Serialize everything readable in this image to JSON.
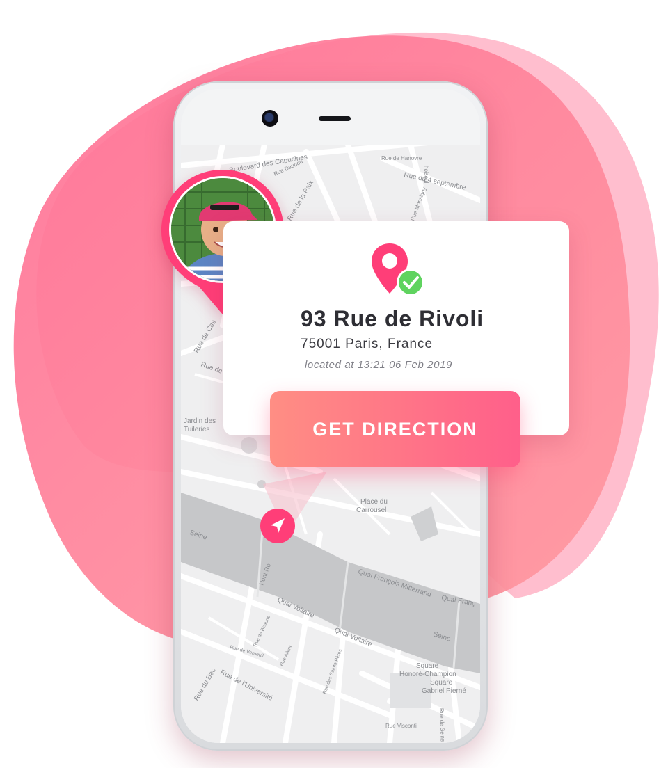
{
  "colors": {
    "accent": "#ff3e78",
    "blob_main": "#ff7fa0",
    "blob_light": "#ffb0c4",
    "check_green": "#5fd35f",
    "button_start": "#ff8e84",
    "button_end": "#ff5f8a"
  },
  "location_card": {
    "icon": "location-pin-check-icon",
    "address": "93 Rue de Rivoli",
    "city": "75001 Paris, France",
    "located_at": "located at 13:21 06 Feb 2019"
  },
  "actions": {
    "get_direction_label": "GET DIRECTION"
  },
  "avatar": {
    "icon": "avatar-child-photo"
  },
  "nav_marker": {
    "icon": "navigation-arrow-icon"
  },
  "map_labels": {
    "boulevard_capucines": "Boulevard des Capucines",
    "rue_hanovre": "Rue de Hanovre",
    "rue_4_septembre": "Rue du 4 septembre",
    "rue_daunou": "Rue Daunou",
    "rue_paix": "Rue de la Paix",
    "rue_monsigny": "Rue Monsigny",
    "choiseul": "hoiseul",
    "rue_de_cas": "Rue de Cas",
    "rue_de": "Rue de",
    "jardin_tuileries": "Jardin des\nTuileries",
    "place_carrousel": "Place du\nCarrousel",
    "seine_1": "Seine",
    "seine_2": "Seine",
    "pont_royal": "Pont Ro",
    "quai_mitterrand": "Quai François Mitterrand",
    "quai_franc": "Quai Franç",
    "quai_voltaire_1": "Quai Voltaire",
    "quai_voltaire_2": "Quai Voltaire",
    "rue_beaune": "Rue de Beaune",
    "rue_verneuil": "Rue de Verneuil",
    "rue_allent": "Rue Allent",
    "rue_saints_peres": "Rue des Saints-Pères",
    "rue_bac": "Rue du Bac",
    "rue_universite": "Rue de l'Université",
    "square_honore": "Square\nHonoré-Champion",
    "square_gabriel": "Square\nGabriel Pierné",
    "rue_visconti": "Rue Visconti",
    "rue_seine": "Rue de Seine"
  }
}
